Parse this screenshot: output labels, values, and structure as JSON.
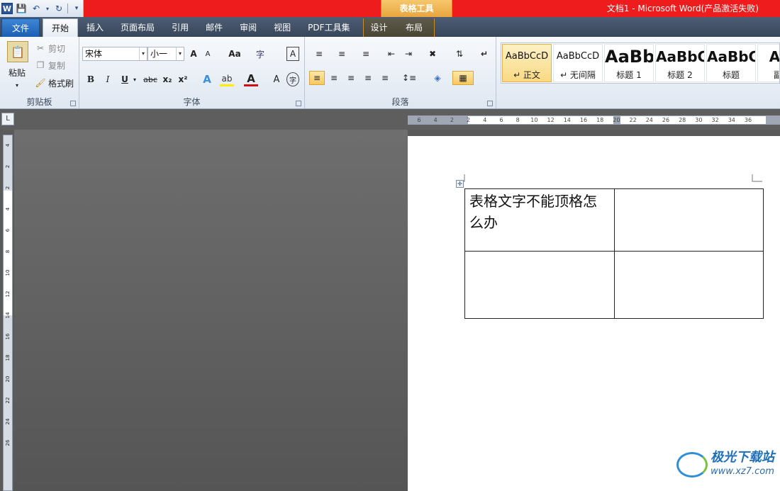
{
  "window": {
    "title": "文档1 - Microsoft Word(产品激活失败)",
    "context_title": "表格工具"
  },
  "qat": {
    "icons": [
      "word-icon",
      "save-icon",
      "undo-icon",
      "redo-icon",
      "customize-icon"
    ]
  },
  "tabs": [
    {
      "label": "文件"
    },
    {
      "label": "开始"
    },
    {
      "label": "插入"
    },
    {
      "label": "页面布局"
    },
    {
      "label": "引用"
    },
    {
      "label": "邮件"
    },
    {
      "label": "审阅"
    },
    {
      "label": "视图"
    },
    {
      "label": "PDF工具集"
    }
  ],
  "context_tabs": [
    {
      "label": "设计"
    },
    {
      "label": "布局"
    }
  ],
  "clipboard": {
    "paste": "粘贴",
    "cut": "剪切",
    "copy": "复制",
    "format_painter": "格式刷",
    "label": "剪贴板"
  },
  "font": {
    "name": "宋体",
    "size": "小一",
    "label": "字体",
    "bold": "B",
    "italic": "I",
    "underline": "U",
    "strike": "abc",
    "sub": "x₂",
    "sup": "x²",
    "grow": "A",
    "shrink": "A",
    "case": "Aa",
    "clear": "A"
  },
  "paragraph": {
    "label": "段落"
  },
  "styles": [
    {
      "sample": "AaBbCcD",
      "name": "↵ 正文"
    },
    {
      "sample": "AaBbCcD",
      "name": "↵ 无间隔"
    },
    {
      "sample": "AaBb",
      "name": "标题 1"
    },
    {
      "sample": "AaBbC",
      "name": "标题 2"
    },
    {
      "sample": "AaBbC",
      "name": "标题"
    },
    {
      "sample": "AaI",
      "name": "副标"
    }
  ],
  "ruler": {
    "h_ticks": [
      "6",
      "4",
      "2",
      "2",
      "4",
      "6",
      "8",
      "10",
      "12",
      "14",
      "16",
      "18",
      "20",
      "22",
      "24",
      "26",
      "28",
      "30",
      "32",
      "34",
      "36"
    ],
    "v_ticks": [
      "4",
      "2",
      "2",
      "4",
      "6",
      "8",
      "10",
      "12",
      "14",
      "16",
      "18",
      "20",
      "22",
      "24",
      "26"
    ]
  },
  "document": {
    "table": [
      [
        "表格文字不能顶格怎么办",
        ""
      ],
      [
        "",
        ""
      ]
    ]
  },
  "watermark": {
    "cn": "极光下载站",
    "url": "www.xz7.com"
  }
}
